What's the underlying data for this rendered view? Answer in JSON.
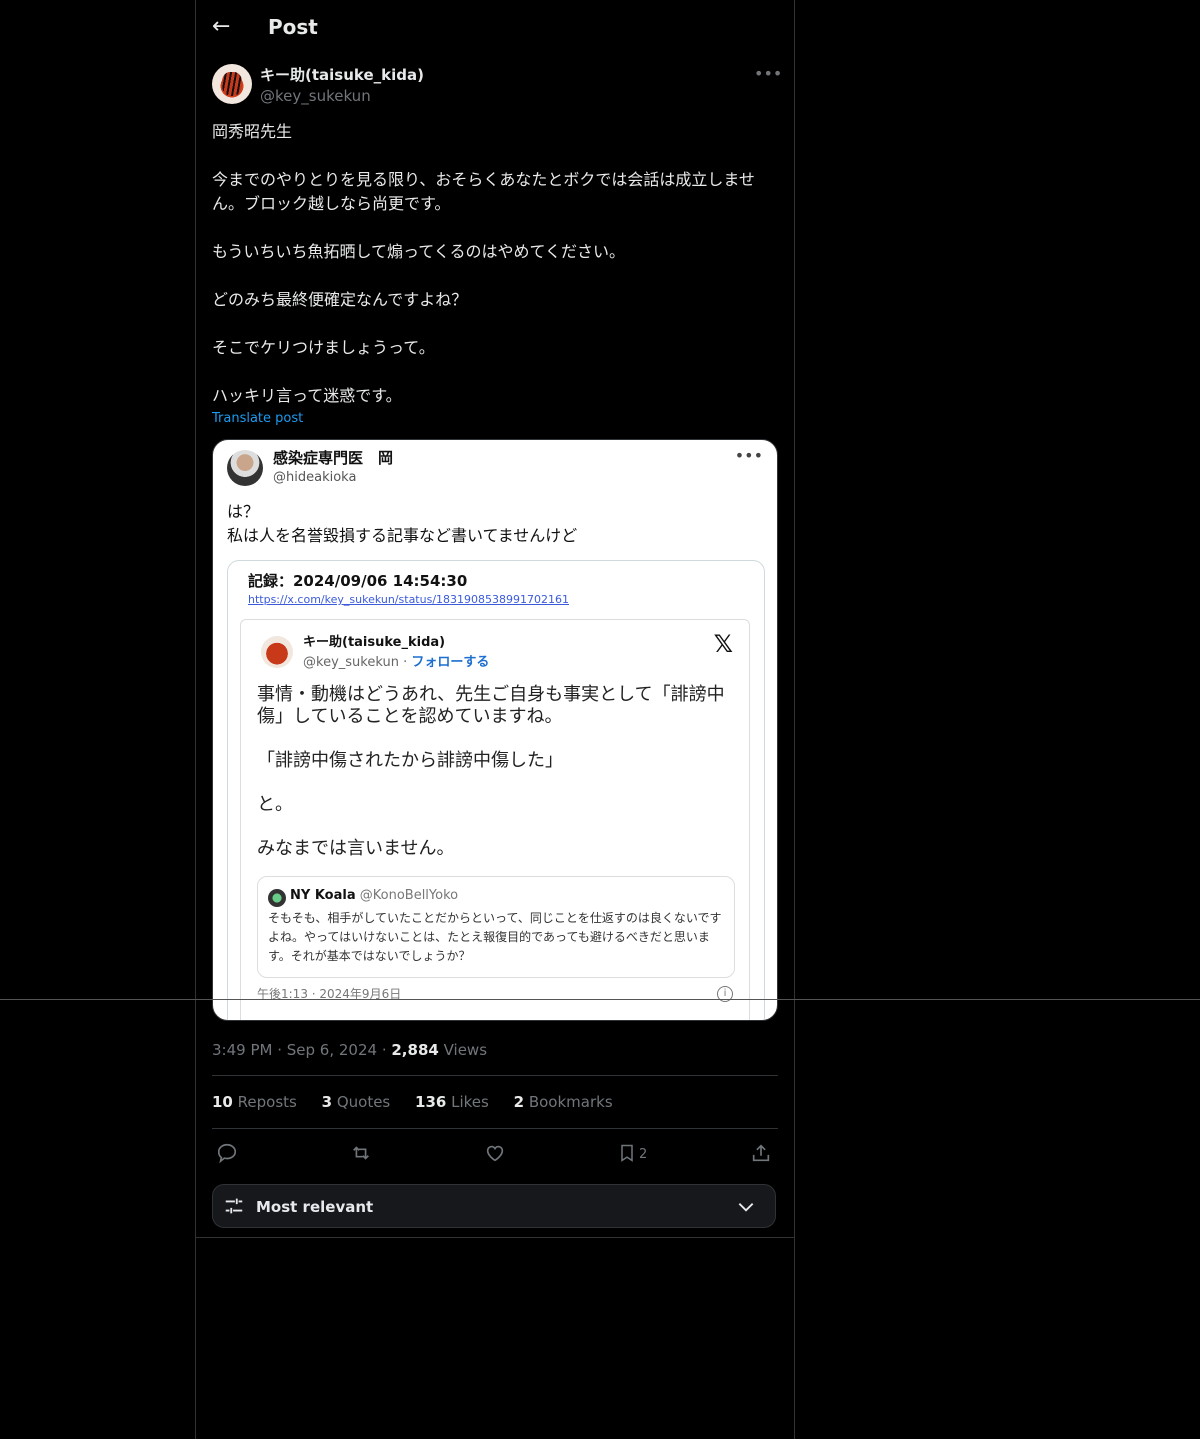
{
  "header": {
    "back_icon": "arrow-left-icon",
    "title": "Post"
  },
  "author": {
    "name": "キー助(taisuke_kida)",
    "handle": "@key_sukekun"
  },
  "tweet": {
    "paragraphs": [
      "岡秀昭先生",
      "今までのやりとりを見る限り、おそらくあなたとボクでは会話は成立しません。ブロック越しなら尚更です。",
      "もういちいち魚拓晒して煽ってくるのはやめてください。",
      "どのみち最終便確定なんですよね？",
      "そこでケリつけましょうって。",
      "ハッキリ言って迷惑です。"
    ],
    "translate": "Translate post"
  },
  "media": {
    "name": "感染症専門医　岡",
    "handle": "@hideakioka",
    "text_line1": "は？",
    "text_line2": "私は人を名誉毀損する記事など書いてませんけど",
    "record": "記録：2024/09/06 14:54:30",
    "record_link": "https://x.com/key_sukekun/status/1831908538991702161",
    "inner": {
      "name": "キー助(taisuke_kida)",
      "handle": "@key_sukekun",
      "dot": " · ",
      "follow": "フォローする",
      "logo": "𝕏",
      "body": [
        "事情・動機はどうあれ、先生ご自身も事実として「誹謗中傷」していることを認めていますね。",
        "「誹謗中傷されたから誹謗中傷した」",
        "と。",
        "みなまでは言いません。"
      ],
      "quote_name": "NY Koala",
      "quote_handle": "@KonoBellYoko",
      "quote_text": "そもそも、相手がしていたことだからといって、同じことを仕返すのは良くないですよね。やってはいけないことは、たとえ報復目的であっても避けるべきだと思います。それが基本ではないでしょうか？",
      "date": "午後1:13 · 2024年9月6日",
      "info": "i"
    }
  },
  "meta": {
    "time": "3:49 PM",
    "dot": " · ",
    "date": "Sep 6, 2024",
    "views_count": "2,884",
    "views_label": " Views"
  },
  "stats": [
    {
      "count": "10",
      "label": " Reposts"
    },
    {
      "count": "3",
      "label": " Quotes"
    },
    {
      "count": "136",
      "label": " Likes"
    },
    {
      "count": "2",
      "label": " Bookmarks"
    }
  ],
  "actions": {
    "bookmark_count": "2"
  },
  "sort": {
    "label": "Most relevant"
  },
  "colors": {
    "accent": "#1d9bf0",
    "border": "#2f3336",
    "muted": "#71767b"
  }
}
